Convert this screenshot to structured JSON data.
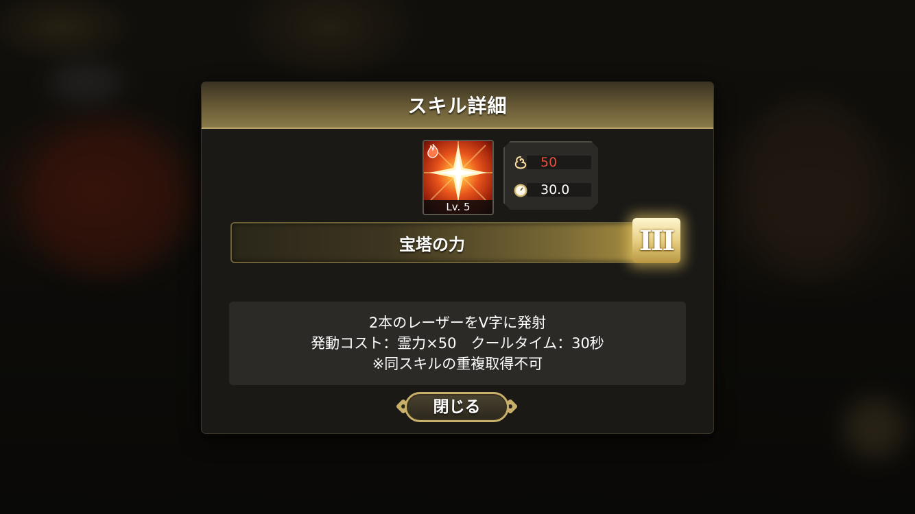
{
  "dialog": {
    "title": "スキル詳細",
    "close_label": "閉じる"
  },
  "skill": {
    "name": "宝塔の力",
    "level_label": "Lv. 5",
    "element_icon": "fire-element-icon",
    "rank": "III",
    "description_lines": [
      "2本のレーザーをV字に発射",
      "発動コスト：霊力×50　クールタイム：30秒",
      "※同スキルの重複取得不可"
    ]
  },
  "stats": {
    "cost": {
      "icon": "spirit-power-icon",
      "value": "50",
      "color": "#e8503a"
    },
    "cooldown": {
      "icon": "stopwatch-icon",
      "value": "30.0",
      "color": "#ffffff"
    }
  },
  "colors": {
    "accent_gold": "#c9b06a",
    "cost_red": "#e8503a"
  }
}
